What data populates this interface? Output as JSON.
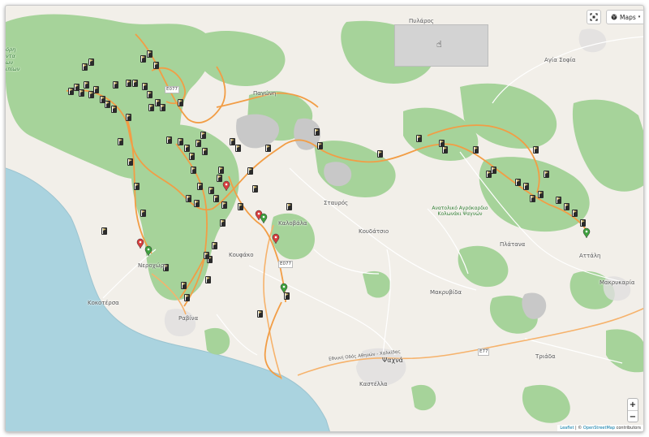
{
  "controls": {
    "layer_button_label": "Maps",
    "zoom_in_label": "+",
    "zoom_out_label": "−"
  },
  "attribution": {
    "leaflet": "Leaflet",
    "separator": " | © ",
    "osm": "OpenStreetMap",
    "suffix": " contributors"
  },
  "places": [
    {
      "name": "Πυλάρος"
    },
    {
      "name": "Αγία Σοφία"
    },
    {
      "name": "Παγώνη"
    },
    {
      "name": "Σταυρός"
    },
    {
      "name": "Καλοβάλα"
    },
    {
      "name": "Κουδάτσιο"
    },
    {
      "name": "Ανατολικό Αγρόκαρδιο Κολωνάκι Ψαγνών"
    },
    {
      "name": "Νεροχώρι"
    },
    {
      "name": "Κουφάκο"
    },
    {
      "name": "Κοκοτέρσα"
    },
    {
      "name": "Ραβίνα"
    },
    {
      "name": "Μακρυβίδα"
    },
    {
      "name": "Ψαχνά"
    },
    {
      "name": "Καστέλλα"
    },
    {
      "name": "Τριάδα"
    },
    {
      "name": "Αττάλη"
    },
    {
      "name": "Μακρυκαρία"
    },
    {
      "name": "Πλάτανα"
    },
    {
      "name": "όρη ντα ων ιπίων"
    }
  ],
  "roads": [
    {
      "name": "E077"
    },
    {
      "name": "E077"
    },
    {
      "name": "Ε77"
    },
    {
      "name": "Εθνική Οδός Αθηνών - Χαλκίδας"
    }
  ],
  "colors": {
    "land": "#f2efe9",
    "forest": "#a6d39a",
    "sea": "#aad3df",
    "quarry": "#c8c8c8",
    "route": "#f29d45",
    "minor_road": "#ffffff",
    "marker_dark": "#2b2b2b",
    "marker_flag": "#d9c277",
    "pin_red": "#d63e3e",
    "pin_green": "#3ea03e"
  },
  "icons": {
    "fullscreen": "fullscreen-icon",
    "layers": "globe-icon",
    "caret": "caret-down-icon",
    "cursor": "hand-cursor-icon",
    "trail_marker": "flag-marker-icon",
    "pin": "map-pin-icon"
  }
}
